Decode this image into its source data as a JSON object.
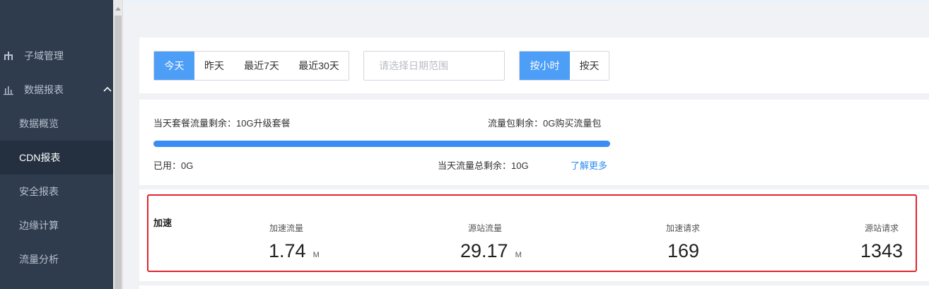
{
  "sidebar": {
    "items": [
      {
        "label": "子域管理",
        "icon": "hierarchy-icon"
      },
      {
        "label": "数据报表",
        "icon": "bar-chart-icon",
        "expanded": true
      },
      {
        "label": "数据概览"
      },
      {
        "label": "CDN报表",
        "active": true
      },
      {
        "label": "安全报表"
      },
      {
        "label": "边缘计算"
      },
      {
        "label": "流量分析"
      }
    ]
  },
  "filters": {
    "range_buttons": [
      "今天",
      "昨天",
      "最近7天",
      "最近30天"
    ],
    "range_selected": "今天",
    "date_placeholder": "请选择日期范围",
    "granularity_buttons": [
      "按小时",
      "按天"
    ],
    "granularity_selected": "按小时"
  },
  "quota": {
    "remaining_label": "当天套餐流量剩余：10G",
    "upgrade_link": "升级套餐",
    "package_label": "流量包剩余：0G",
    "buy_link": "购买流量包",
    "used_label": "已用：0G",
    "total_label": "当天流量总剩余：10G",
    "more_link": "了解更多",
    "progress_remaining": 1.0
  },
  "stats": {
    "section_title": "加速",
    "items": [
      {
        "label": "加速流量",
        "value": "1.74",
        "unit": "M"
      },
      {
        "label": "源站流量",
        "value": "29.17",
        "unit": "M"
      },
      {
        "label": "加速请求",
        "value": "169",
        "unit": ""
      },
      {
        "label": "源站请求",
        "value": "1343",
        "unit": ""
      }
    ]
  },
  "colors": {
    "sidebar_bg": "#2f3c4e",
    "accent": "#4d9ef7",
    "progress": "#3a8ef3",
    "highlight_border": "#e0262e",
    "link": "#2d8cf0"
  }
}
